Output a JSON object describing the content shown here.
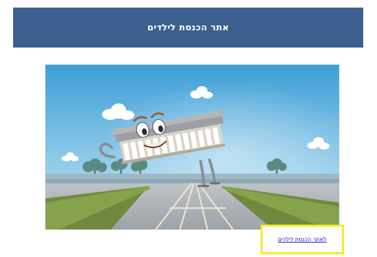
{
  "header": {
    "title": "אתר הכנסת לילדים",
    "background_color": "#3c5f8f"
  },
  "hero_image": {
    "icon": "knesset-building-mascot-illustration"
  },
  "kids_link": {
    "label": "לאתר הכנסת לילדים",
    "highlight_color": "#f4ea2a",
    "link_color": "#1a0dab"
  }
}
